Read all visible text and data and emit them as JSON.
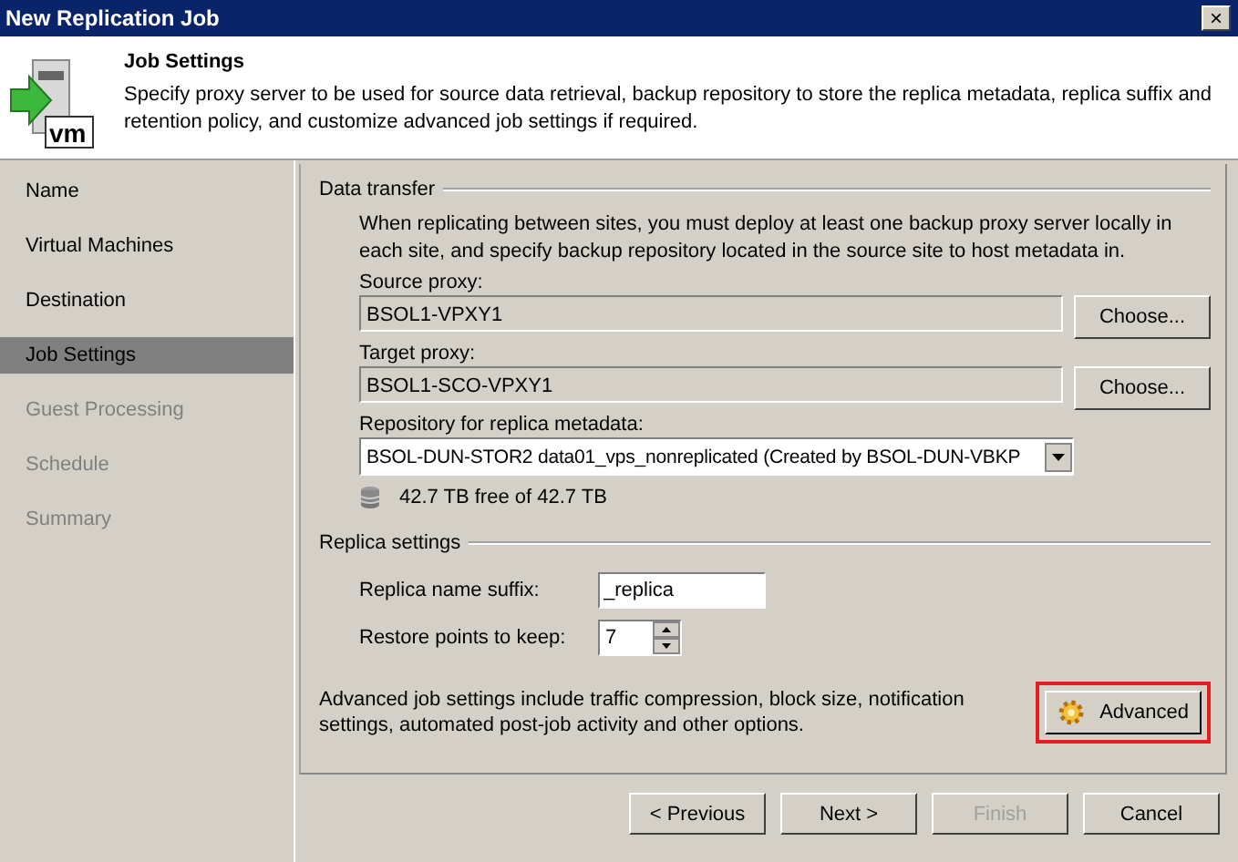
{
  "window": {
    "title": "New Replication Job",
    "close": "×"
  },
  "header": {
    "icon_label": "vm",
    "title": "Job Settings",
    "description": "Specify proxy server to be used for source data retrieval, backup repository to store the replica metadata, replica suffix and retention policy, and customize advanced job settings if required."
  },
  "sidebar": {
    "items": [
      {
        "label": "Name",
        "selected": false,
        "disabled": false
      },
      {
        "label": "Virtual Machines",
        "selected": false,
        "disabled": false
      },
      {
        "label": "Destination",
        "selected": false,
        "disabled": false
      },
      {
        "label": "Job Settings",
        "selected": true,
        "disabled": false
      },
      {
        "label": "Guest Processing",
        "selected": false,
        "disabled": true
      },
      {
        "label": "Schedule",
        "selected": false,
        "disabled": true
      },
      {
        "label": "Summary",
        "selected": false,
        "disabled": true
      }
    ]
  },
  "data_transfer": {
    "title": "Data transfer",
    "note": "When replicating between sites, you must deploy at least one backup proxy server locally in each site, and specify backup repository located in the source site to host metadata in.",
    "source_proxy": {
      "label": "Source proxy:",
      "value": "BSOL1-VPXY1",
      "button": "Choose..."
    },
    "target_proxy": {
      "label": "Target proxy:",
      "value": "BSOL1-SCO-VPXY1",
      "button": "Choose..."
    },
    "repository": {
      "label": "Repository for replica metadata:",
      "value": "BSOL-DUN-STOR2 data01_vps_nonreplicated (Created by BSOL-DUN-VBKP",
      "free": "42.7 TB free of 42.7 TB"
    }
  },
  "replica_settings": {
    "title": "Replica settings",
    "suffix": {
      "label": "Replica name suffix:",
      "value": "_replica"
    },
    "restore_points": {
      "label": "Restore points to keep:",
      "value": "7"
    }
  },
  "advanced": {
    "note": "Advanced job settings include traffic compression, block size, notification settings, automated post-job activity and other options.",
    "button": "Advanced",
    "highlighted": true
  },
  "footer": {
    "buttons": [
      {
        "label": "< Previous",
        "disabled": false
      },
      {
        "label": "Next >",
        "disabled": false
      },
      {
        "label": "Finish",
        "disabled": true
      },
      {
        "label": "Cancel",
        "disabled": false
      }
    ]
  }
}
